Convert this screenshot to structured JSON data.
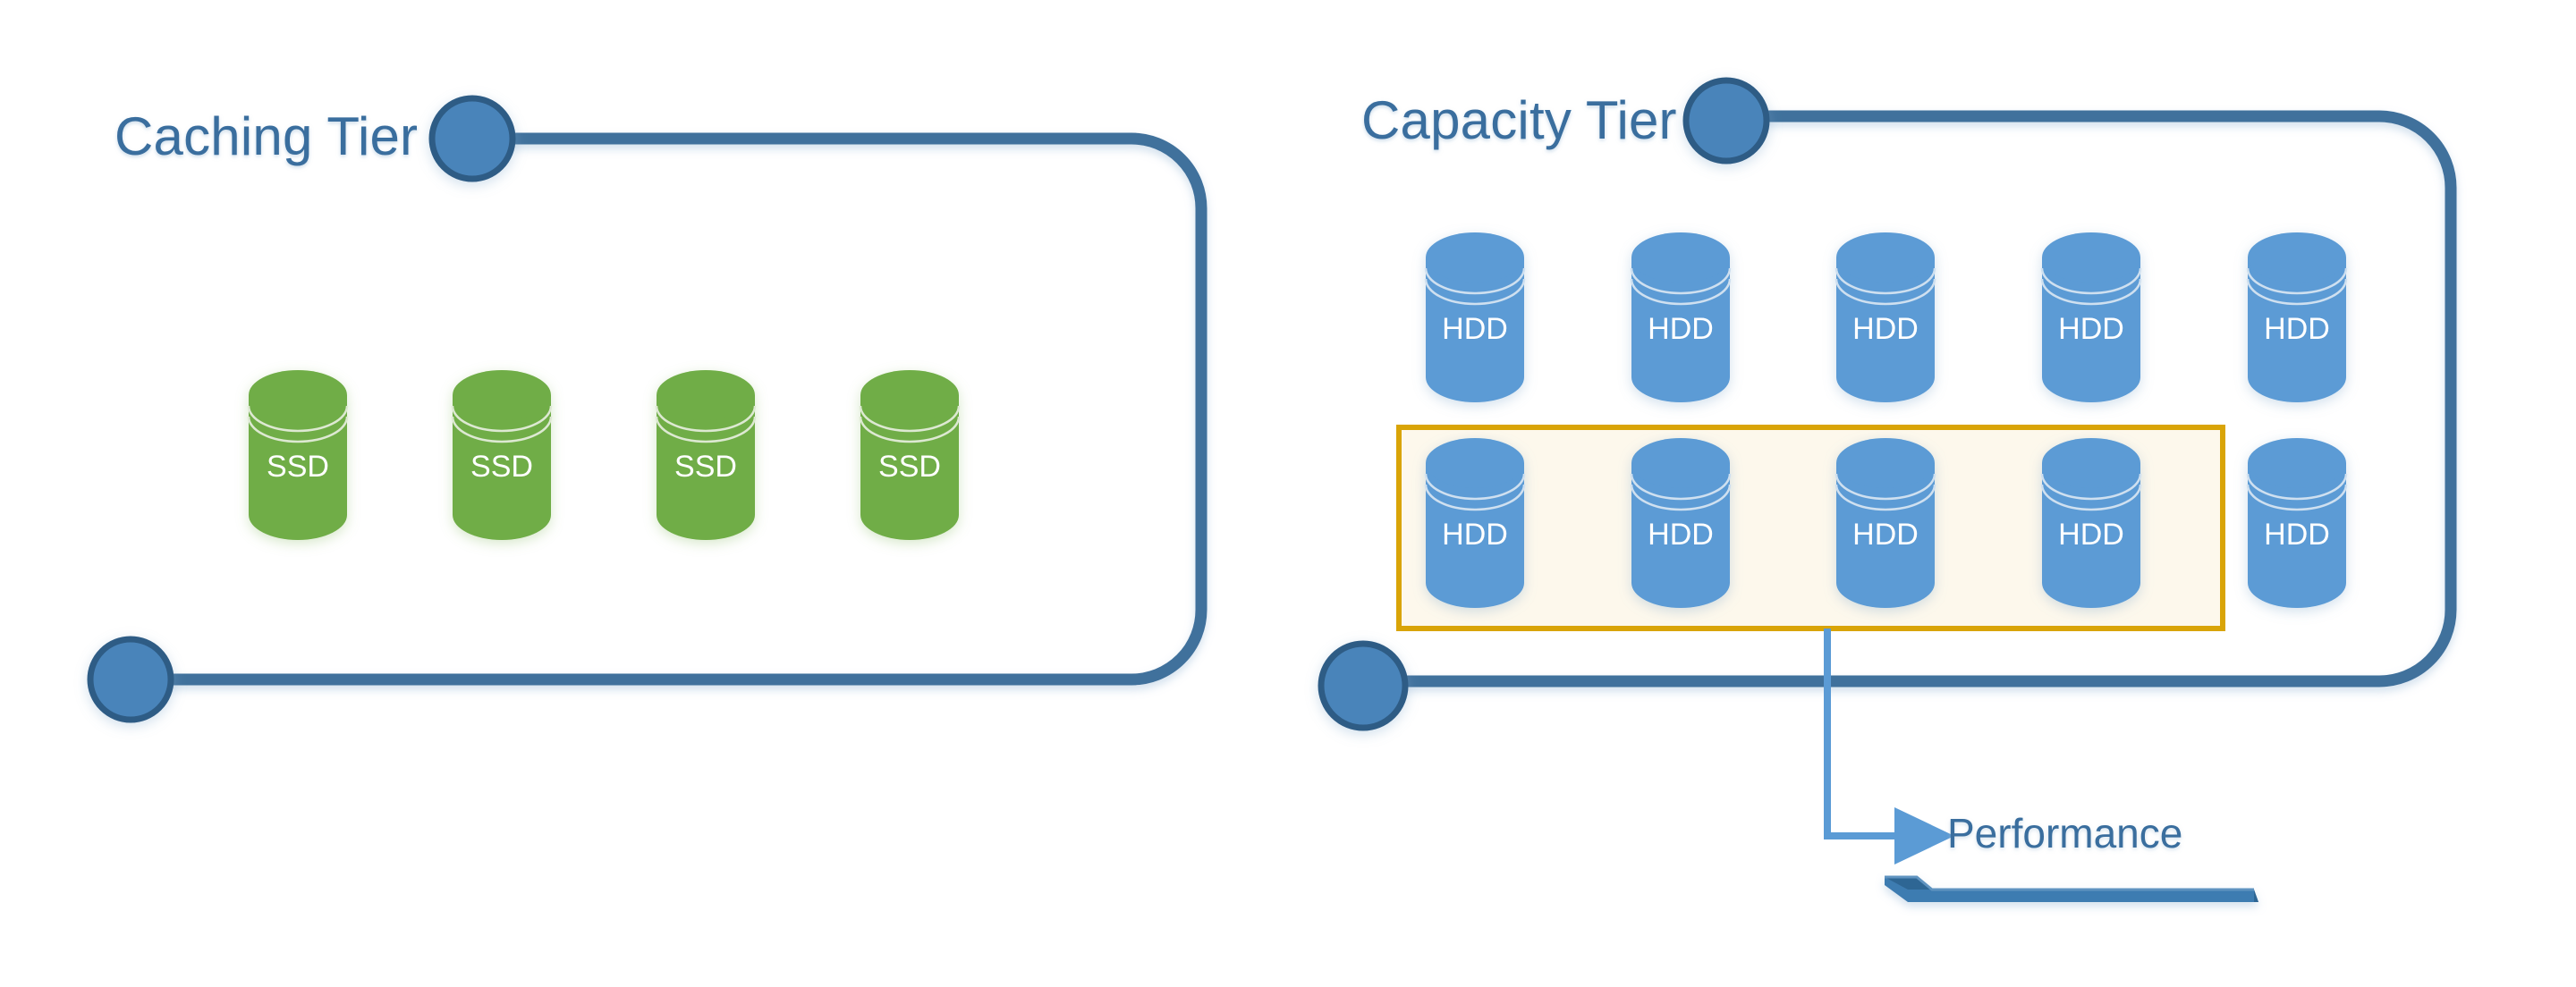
{
  "diagram": {
    "title_hidden": "",
    "colors": {
      "ssd_fill": "#70AD47",
      "hdd_fill": "#5B9BD5",
      "bracket_stroke": "#41719C",
      "node_fill": "#4A84BA",
      "node_stroke": "#2E5C85",
      "highlight_border": "#D9A407",
      "highlight_fill": "#FDF8EC",
      "label_text": "#3A6E9E",
      "arrow_color": "#5B9BD5",
      "rule_color": "#41719C",
      "bar_color": "#3E7CB1"
    }
  },
  "caching_tier": {
    "label": "Caching Tier",
    "disks": [
      {
        "label": "SSD"
      },
      {
        "label": "SSD"
      },
      {
        "label": "SSD"
      },
      {
        "label": "SSD"
      }
    ]
  },
  "capacity_tier": {
    "label": "Capacity Tier",
    "row_top": [
      {
        "label": "HDD"
      },
      {
        "label": "HDD"
      },
      {
        "label": "HDD"
      },
      {
        "label": "HDD"
      },
      {
        "label": "HDD"
      }
    ],
    "row_bottom": [
      {
        "label": "HDD"
      },
      {
        "label": "HDD"
      },
      {
        "label": "HDD"
      },
      {
        "label": "HDD"
      },
      {
        "label": "HDD"
      }
    ]
  },
  "callout": {
    "label": "Performance"
  }
}
